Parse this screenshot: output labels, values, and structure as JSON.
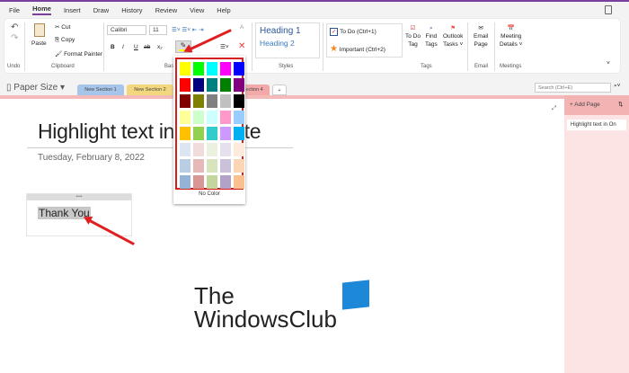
{
  "menu": {
    "tabs": [
      "File",
      "Home",
      "Insert",
      "Draw",
      "History",
      "Review",
      "View",
      "Help"
    ],
    "active": "Home"
  },
  "ribbon": {
    "undo_label": "Undo",
    "clipboard": {
      "paste": "Paste",
      "cut": "Cut",
      "copy": "Copy",
      "format_painter": "Format Painter",
      "group": "Clipboard"
    },
    "basic_text": {
      "font": "Calibri",
      "size": "11",
      "bold": "B",
      "italic": "I",
      "underline": "U",
      "strike": "ab",
      "subscript": "x₂",
      "group": "Basic Text"
    },
    "styles": {
      "heading1": "Heading 1",
      "heading2": "Heading 2",
      "group": "Styles"
    },
    "tags": {
      "todo": "To Do (Ctrl+1)",
      "important": "Important (Ctrl+2)",
      "todo_tag": [
        "To Do",
        "Tag"
      ],
      "find_tags": [
        "Find",
        "Tags"
      ],
      "outlook_tasks": [
        "Outlook",
        "Tasks ˅"
      ],
      "group": "Tags"
    },
    "email": {
      "label": [
        "Email",
        "Page"
      ],
      "group": "Email"
    },
    "meetings": {
      "label": [
        "Meeting",
        "Details ˅"
      ],
      "group": "Meetings"
    }
  },
  "sections": {
    "paper_size": "Paper Size ▾",
    "tabs": [
      "New Section 1",
      "New Section 2",
      "New Section 4"
    ],
    "add": "+",
    "search_placeholder": "Search (Ctrl+E)"
  },
  "page": {
    "title": "Highlight text in OneNote",
    "date": "Tuesday, February 8, 2022",
    "note_text": "Thank You"
  },
  "pages_pane": {
    "add_page": "+ Add Page",
    "pages": [
      "Highlight text in On"
    ]
  },
  "highlight_palette": {
    "colors": [
      "#ffff00",
      "#00ff00",
      "#00ffff",
      "#ff00ff",
      "#0000ff",
      "#ff0000",
      "#000080",
      "#008080",
      "#008000",
      "#800080",
      "#800000",
      "#808000",
      "#808080",
      "#c0c0c0",
      "#000000",
      "#ffff99",
      "#ccffcc",
      "#ccffff",
      "#ff99cc",
      "#99ccff",
      "#ffc000",
      "#92d050",
      "#33cccc",
      "#cc99ff",
      "#00b0f0",
      "#dce6f2",
      "#f2dcdb",
      "#ebf1de",
      "#e6e0ec",
      "#fdeada",
      "#b9cde5",
      "#e6b9b8",
      "#d7e4bd",
      "#ccc1da",
      "#fcd5b5",
      "#95b3d7",
      "#d99694",
      "#c3d69b",
      "#b3a2c7",
      "#fac090"
    ],
    "no_color": "No Color"
  },
  "watermark": {
    "line1": "The",
    "line2": "WindowsClub"
  },
  "accent": "#7b3fa0"
}
